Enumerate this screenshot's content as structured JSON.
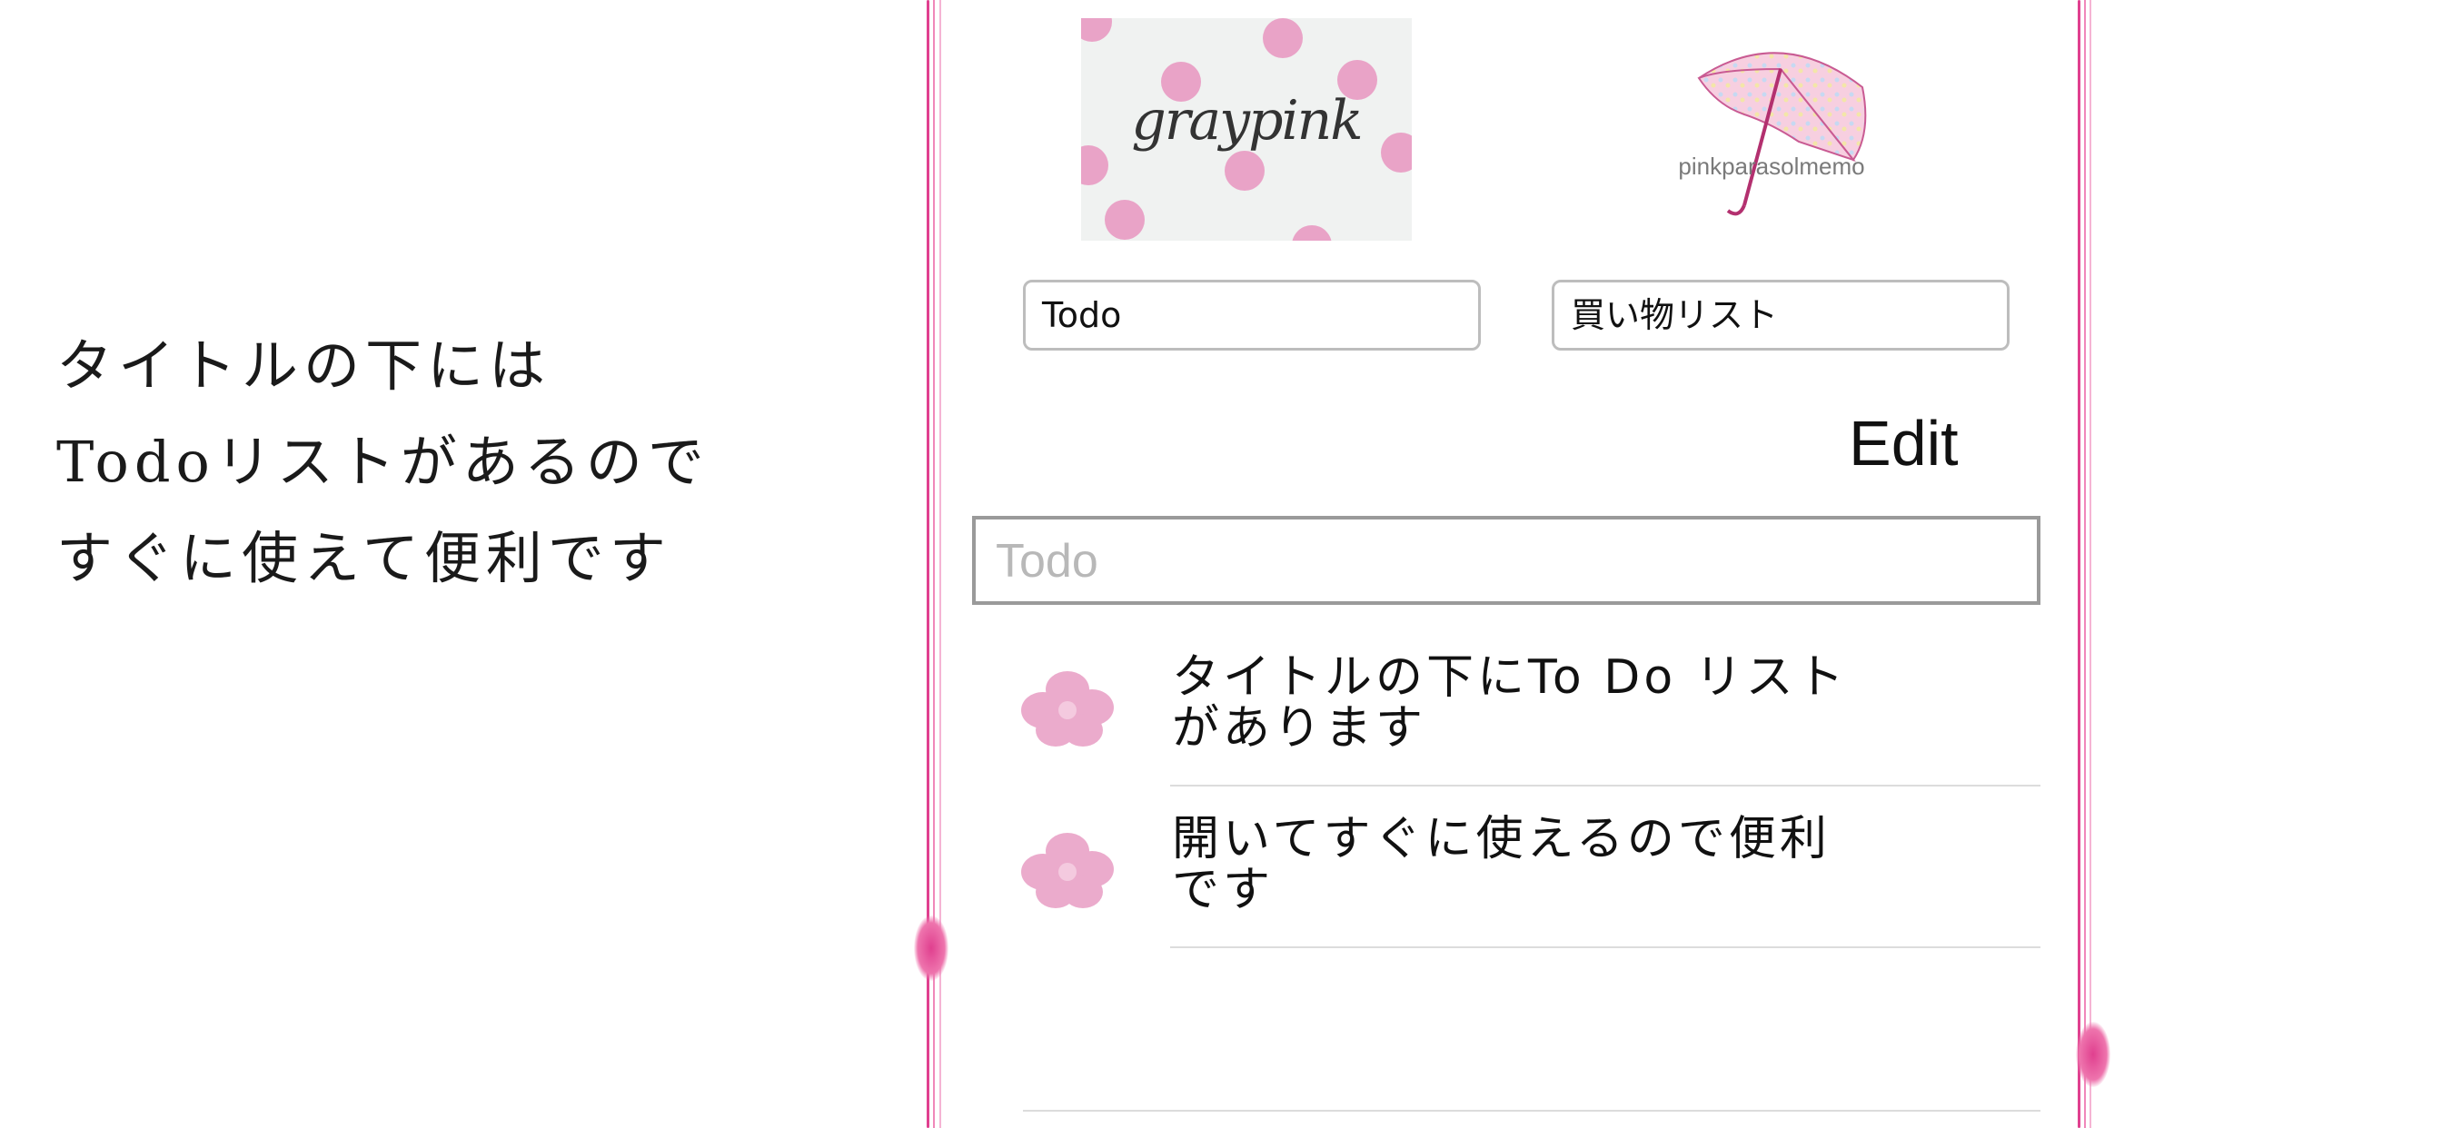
{
  "caption": {
    "lines": [
      "タイトルの下には",
      "Todoリストがあるので",
      "すぐに使えて便利です"
    ]
  },
  "logos": {
    "left_text": "graypink",
    "right_text": "pinkparasolmemo"
  },
  "segments": {
    "todo_label": "Todo",
    "shopping_label": "買い物リスト"
  },
  "edit_label": "Edit",
  "input": {
    "placeholder": "Todo"
  },
  "todos": [
    {
      "line1": "タイトルの下にTo Do リスト",
      "line2": "があります"
    },
    {
      "line1": "開いてすぐに使えるので便利",
      "line2": "です"
    }
  ],
  "colors": {
    "frame_pink": "#e0408f",
    "flower_pink": "#e9a3c7",
    "polka_dot": "#e9a3c7"
  },
  "icons": [
    "flower-icon",
    "parasol-icon"
  ]
}
